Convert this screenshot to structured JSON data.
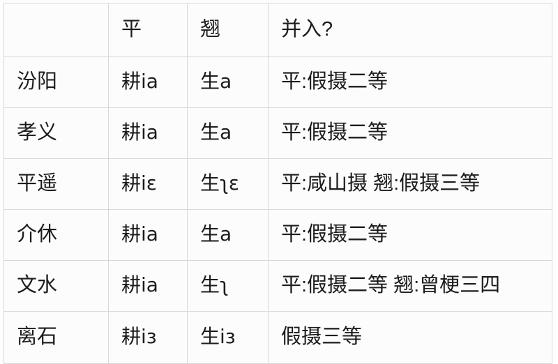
{
  "table": {
    "title": "",
    "columns": [
      {
        "key": "place",
        "label": ""
      },
      {
        "key": "ping",
        "label": "平"
      },
      {
        "key": "qiao",
        "label": "翘"
      },
      {
        "key": "merge",
        "label": "并入?"
      }
    ],
    "rows": [
      {
        "place": "汾阳",
        "ping": "耕ia",
        "qiao": "生a",
        "merge": "平:假摄二等"
      },
      {
        "place": "孝义",
        "ping": "耕ia",
        "qiao": "生a",
        "merge": "平:假摄二等"
      },
      {
        "place": "平遥",
        "ping": "耕iɛ",
        "qiao": "生ʅɛ",
        "merge": "平:咸山摄 翘:假摄三等"
      },
      {
        "place": "介休",
        "ping": "耕ia",
        "qiao": "生a",
        "merge": "平:假摄二等"
      },
      {
        "place": "文水",
        "ping": "耕ia",
        "qiao": "生ʅ",
        "merge": "平:假摄二等 翘:曾梗三四"
      },
      {
        "place": "离石",
        "ping": "耕iɜ",
        "qiao": "生iɜ",
        "merge": "假摄三等"
      }
    ]
  },
  "style": {
    "border_color": "#d8d8d8",
    "text_color": "#1c1c1c",
    "background": "#fcfcfc"
  }
}
